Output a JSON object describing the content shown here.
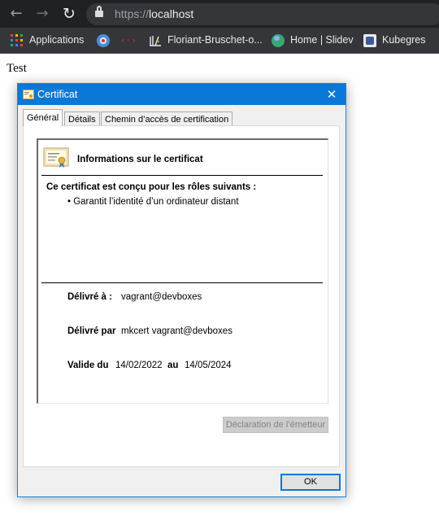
{
  "browser": {
    "url_scheme": "https://",
    "url_host": "localhost",
    "icons": {
      "back": "back-arrow-icon",
      "forward": "forward-arrow-icon",
      "reload": "reload-icon",
      "lock": "lock-icon"
    }
  },
  "bookmarks": [
    {
      "label": "Applications",
      "icon": "apps-grid-icon"
    },
    {
      "label": "",
      "icon": "bookmark-red-icon"
    },
    {
      "label": "",
      "icon": "code-icon"
    },
    {
      "label": "Floriant-Bruschet-o...",
      "icon": "library-icon"
    },
    {
      "label": "Home | Slidev",
      "icon": "globe-icon"
    },
    {
      "label": "Kubegres",
      "icon": "kubegres-icon"
    }
  ],
  "page": {
    "text": "Test"
  },
  "dialog": {
    "title": "Certificat",
    "close_glyph": "✕",
    "tabs": [
      "Général",
      "Détails",
      "Chemin d’accès de certification"
    ],
    "active_tab": 0,
    "info_heading": "Informations sur le certificat",
    "purpose_heading": "Ce certificat est conçu pour les rôles suivants :",
    "purposes": [
      "• Garantit l’identité d’un ordinateur distant"
    ],
    "issued_to_label": "Délivré à :",
    "issued_to_value": "vagrant@devboxes",
    "issued_by_label": "Délivré par",
    "issued_by_value": "mkcert vagrant@devboxes",
    "valid_from_label": "Valide du",
    "valid_from_value": "14/02/2022",
    "valid_to_label": "au",
    "valid_to_value": "14/05/2024",
    "issuer_statement_button": "Déclaration de l’émetteur",
    "ok_button": "OK"
  },
  "colors": {
    "chrome_bg": "#202124",
    "bookmarks_bg": "#35363a",
    "dialog_accent": "#0a78d7"
  }
}
